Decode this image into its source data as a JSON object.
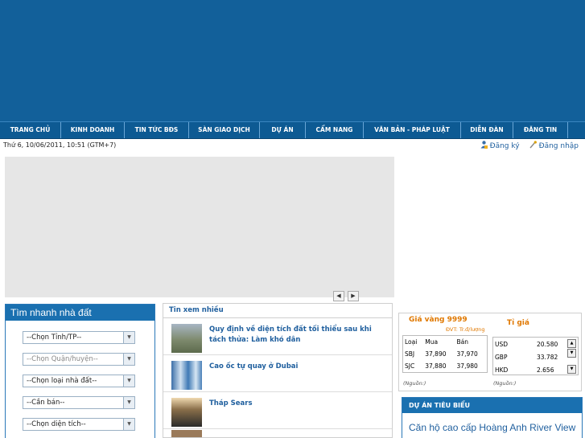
{
  "nav": {
    "items": [
      "TRANG CHỦ",
      "KINH DOANH",
      "TIN TỨC BĐS",
      "SÀN GIAO DỊCH",
      "DỰ ÁN",
      "CẨM NANG",
      "VĂN BẢN - PHÁP LUẬT",
      "DIỄN ĐÀN",
      "ĐĂNG TIN"
    ]
  },
  "header": {
    "datetime": "Thứ 6, 10/06/2011, 10:51 (GTM+7)",
    "register": "Đăng ký",
    "login": "Đăng nhập"
  },
  "search": {
    "title": "Tìm nhanh nhà đất",
    "selects": [
      "--Chọn Tỉnh/TP--",
      "--Chọn Quận/huyện--",
      "--Chọn loại nhà đất--",
      "--Cần bán--",
      "--Chọn diện tích--"
    ]
  },
  "news": {
    "tab": "Tin xem nhiều",
    "items": [
      "Quy định về diện tích đất tối thiểu sau khi tách thửa: Làm khó dân",
      "Cao ốc tự quay ở Dubai",
      "Tháp Sears"
    ]
  },
  "market": {
    "gold_title": "Giá vàng 9999",
    "gold_unit": "ĐVT: Tr.đ/lượng",
    "fx_title": "Tỉ giá",
    "gold_header": [
      "Loại",
      "Mua",
      "Bán"
    ],
    "gold_rows": [
      [
        "SBJ",
        "37,890",
        "37,970"
      ],
      [
        "SJC",
        "37,880",
        "37,980"
      ]
    ],
    "fx_rows": [
      [
        "USD",
        "20.580"
      ],
      [
        "GBP",
        "33.782"
      ],
      [
        "HKD",
        "2.656"
      ]
    ],
    "source": "(Nguồn:)"
  },
  "project": {
    "head": "DỰ ÁN TIÊU BIỂU",
    "title": "Căn hộ cao cấp Hoàng Anh River View"
  },
  "colors": {
    "banner": "#12609a",
    "nav": "#0d5a93",
    "link": "#1f5f9e",
    "orange": "#e07800"
  }
}
